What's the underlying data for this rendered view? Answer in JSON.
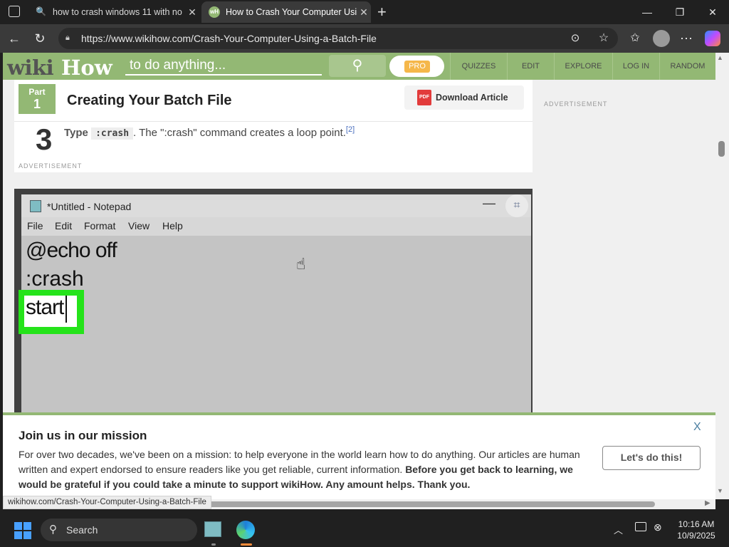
{
  "tabs": [
    {
      "title": "how to crash windows 11 with no",
      "favicon": "search-icon",
      "active": false
    },
    {
      "title": "How to Crash Your Computer Usi",
      "favicon": "wikihow-icon",
      "active": true
    }
  ],
  "window_controls": {
    "minimize": "—",
    "restore": "❐",
    "close": "✕"
  },
  "address_bar": {
    "url": "https://www.wikihow.com/Crash-Your-Computer-Using-a-Batch-File"
  },
  "site_header": {
    "logo_wiki": "wiki",
    "logo_how": "How",
    "search_placeholder": "to do anything...",
    "pro_label": "PRO",
    "nav": [
      "QUIZZES",
      "EDIT",
      "EXPLORE",
      "LOG IN",
      "RANDOM"
    ]
  },
  "article": {
    "part_label": "Part",
    "part_number": "1",
    "section_title": "Creating Your Batch File",
    "download_label": "Download Article",
    "pdf_label": "PDF",
    "step_number": "3",
    "step_type": "Type",
    "step_code": ":crash",
    "step_text": ". The \":crash\" command creates a loop point.",
    "step_ref": "[2]",
    "ad_label": "ADVERTISEMENT",
    "sidebar_ad_label": "ADVERTISEMENT"
  },
  "notepad": {
    "title": "*Untitled - Notepad",
    "menu": [
      "File",
      "Edit",
      "Format",
      "View",
      "Help"
    ],
    "lines": [
      "@echo off",
      ":crash",
      "start"
    ]
  },
  "banner": {
    "title": "Join us in our mission",
    "text": "For over two decades, we've been on a mission: to help everyone in the world learn how to do anything. Our articles are human written and expert endorsed to ensure readers like you get reliable, current information. ",
    "bold_text": "Before you get back to learning, we would be grateful if you could take a minute to support wikiHow. Any amount helps. Thank you.",
    "button_label": "Let's do this!",
    "close_label": "X"
  },
  "status_url": "wikihow.com/Crash-Your-Computer-Using-a-Batch-File",
  "taskbar": {
    "search_label": "Search",
    "time": "10:16 AM",
    "date": "10/9/2025"
  },
  "colors": {
    "brand_green": "#93b874",
    "highlight_green": "#25e31a",
    "pro_orange": "#f5b74a"
  }
}
